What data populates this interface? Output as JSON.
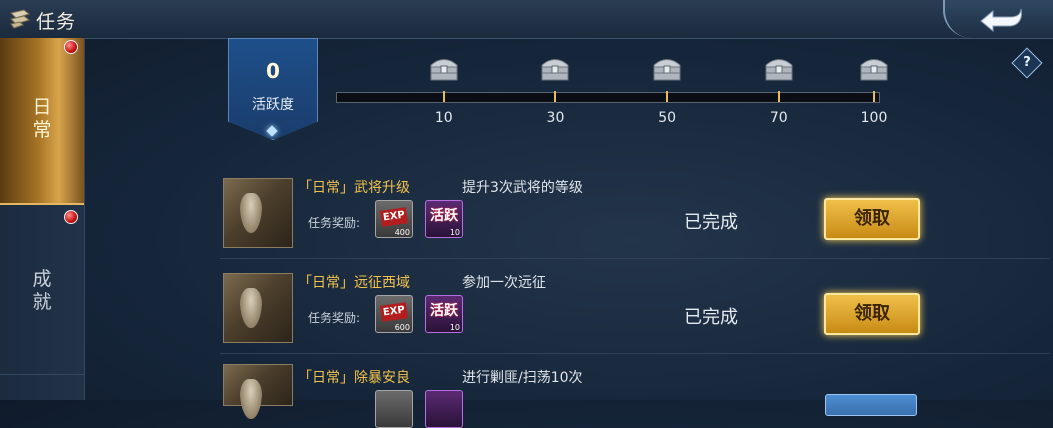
{
  "header": {
    "title": "任务",
    "title_icon": "scroll-icon",
    "back_icon": "back-arrow-icon"
  },
  "sidebar": {
    "tabs": [
      {
        "label": "日\n常",
        "selected": true,
        "has_notification": true
      },
      {
        "label": "成\n就",
        "selected": false,
        "has_notification": true
      }
    ]
  },
  "activity": {
    "value": "0",
    "label": "活跃度",
    "progress_fraction": 0,
    "milestones": [
      "10",
      "30",
      "50",
      "70",
      "100"
    ],
    "chest_icon": "silver-chest-icon"
  },
  "help_label": "?",
  "tasks": [
    {
      "name": "「日常」武将升级",
      "desc": "提升3次武将的等级",
      "reward_label": "任务奖励:",
      "rewards": [
        {
          "type": "exp",
          "text": "EXP",
          "count": "400"
        },
        {
          "type": "activity",
          "text": "活跃",
          "count": "10"
        }
      ],
      "status": "已完成",
      "button": "领取"
    },
    {
      "name": "「日常」远征西域",
      "desc": "参加一次远征",
      "reward_label": "任务奖励:",
      "rewards": [
        {
          "type": "exp",
          "text": "EXP",
          "count": "600"
        },
        {
          "type": "activity",
          "text": "活跃",
          "count": "10"
        }
      ],
      "status": "已完成",
      "button": "领取"
    },
    {
      "name": "「日常」除暴安良",
      "desc": "进行剿匪/扫荡10次",
      "reward_label": "",
      "rewards": [],
      "status": "",
      "button": ""
    }
  ],
  "colors": {
    "gold": "#e0b742",
    "task_name": "#f2c24a",
    "red_dot": "#c40f0f"
  }
}
